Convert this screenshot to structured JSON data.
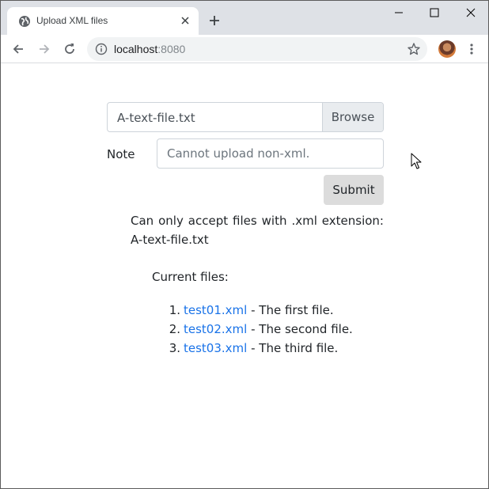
{
  "browser": {
    "tab_title": "Upload XML files",
    "url_host": "localhost",
    "url_port": ":8080",
    "icons": [
      "globe-icon",
      "close-icon",
      "plus-icon",
      "minimize-icon",
      "maximize-icon",
      "window-close-icon",
      "back-arrow-icon",
      "forward-arrow-icon",
      "reload-icon",
      "info-icon",
      "star-icon",
      "menu-dots-icon"
    ]
  },
  "form": {
    "file_name": "A-text-file.txt",
    "browse_label": "Browse",
    "note_label": "Note",
    "note_placeholder": "Cannot upload non-xml.",
    "submit_label": "Submit"
  },
  "message": "Can only accept files with .xml extension: A-text-file.txt",
  "files": {
    "heading": "Current files:",
    "items": [
      {
        "num": "1.",
        "name": "test01.xml",
        "desc": " - The first file."
      },
      {
        "num": "2.",
        "name": "test02.xml",
        "desc": " - The second file."
      },
      {
        "num": "3.",
        "name": "test03.xml",
        "desc": " - The third file."
      }
    ]
  },
  "colors": {
    "link": "#1a73e8",
    "submit_bg": "#dcdcdc",
    "tabstrip_bg": "#dee1e6"
  }
}
